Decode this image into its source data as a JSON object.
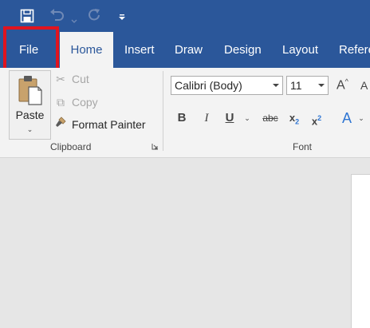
{
  "quick_access": {
    "save_icon": "save-icon",
    "undo_icon": "undo-icon",
    "redo_icon": "redo-icon",
    "customize_icon": "customize-qat-icon"
  },
  "tabs": [
    {
      "label": "File",
      "active": false,
      "highlighted": true
    },
    {
      "label": "Home",
      "active": true
    },
    {
      "label": "Insert"
    },
    {
      "label": "Draw"
    },
    {
      "label": "Design"
    },
    {
      "label": "Layout"
    },
    {
      "label": "Refere"
    }
  ],
  "clipboard": {
    "paste_label": "Paste",
    "cut_label": "Cut",
    "copy_label": "Copy",
    "format_painter_label": "Format Painter",
    "group_label": "Clipboard"
  },
  "font": {
    "name": "Calibri (Body)",
    "size": "11",
    "group_label": "Font",
    "buttons": {
      "bold": "B",
      "italic": "I",
      "underline": "U",
      "strikethrough": "abc",
      "subscript_base": "x",
      "subscript_mark": "2",
      "superscript_base": "x",
      "superscript_mark": "2",
      "grow": "A",
      "shrink": "A",
      "effects": "A"
    }
  },
  "colors": {
    "title_bar": "#2b579a",
    "ribbon": "#f3f3f3",
    "highlight": "#e0141f",
    "document_bg": "#e6e6e6"
  }
}
